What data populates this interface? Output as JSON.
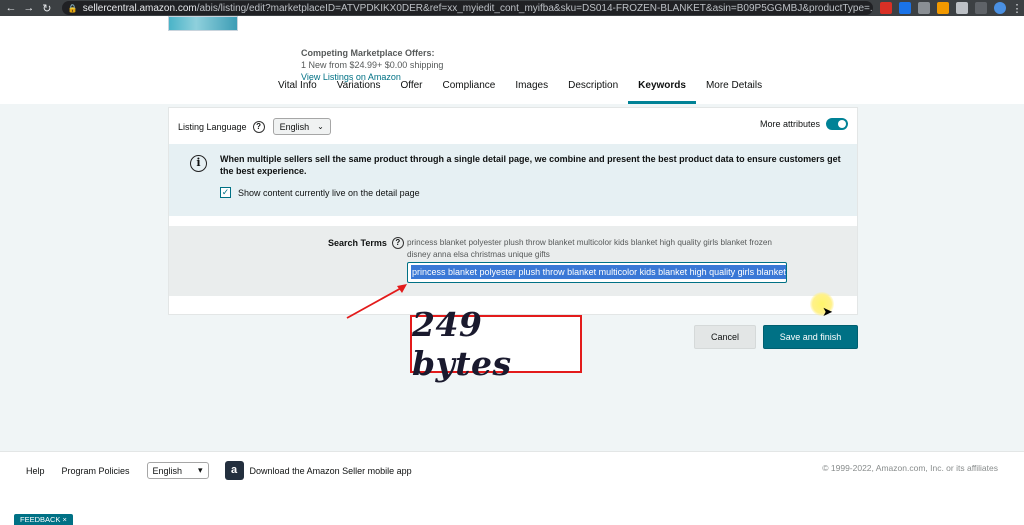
{
  "browser": {
    "url_domain": "sellercentral.amazon.com",
    "url_path": "/abis/listing/edit?marketplaceID=ATVPDKIKX0DER&ref=xx_myiedit_cont_myifba&sku=DS014-FROZEN-BLANKET&asin=B09P5GGMBJ&productType=..."
  },
  "offers": {
    "title": "Competing Marketplace Offers:",
    "line": "1 New  from $24.99+ $0.00 shipping",
    "link": "View Listings on Amazon"
  },
  "tabs": [
    {
      "label": "Vital Info"
    },
    {
      "label": "Variations"
    },
    {
      "label": "Offer"
    },
    {
      "label": "Compliance"
    },
    {
      "label": "Images"
    },
    {
      "label": "Description"
    },
    {
      "label": "Keywords"
    },
    {
      "label": "More Details"
    }
  ],
  "active_tab": "Keywords",
  "listing_language": {
    "label": "Listing Language",
    "value": "English"
  },
  "more_attributes": {
    "label": "More attributes",
    "enabled": true
  },
  "info": {
    "message": "When multiple sellers sell the same product through a single detail page, we combine and present the best product data to ensure customers get the best experience.",
    "checkbox_label": "Show content currently live on the detail page",
    "checked": true
  },
  "search_terms": {
    "label": "Search Terms",
    "current": "princess blanket polyester plush throw blanket multicolor kids blanket high quality girls blanket frozen disney anna elsa christmas unique gifts",
    "input_value": "princess blanket polyester plush throw blanket multicolor kids blanket high quality girls blanket frozen disney anna elsa christmas unique gifts"
  },
  "buttons": {
    "cancel": "Cancel",
    "save": "Save and finish"
  },
  "annotation": {
    "text": "249 bytes"
  },
  "footer": {
    "help": "Help",
    "program_policies": "Program Policies",
    "language": "English",
    "app_text": "Download the Amazon Seller mobile app",
    "app_icon_letter": "a",
    "copyright": "© 1999-2022, Amazon.com, Inc. or its affiliates",
    "feedback": "FEEDBACK ×"
  },
  "colors": {
    "accent": "#008296",
    "annotation_red": "#e31b1b",
    "selection": "#3a78d6"
  }
}
